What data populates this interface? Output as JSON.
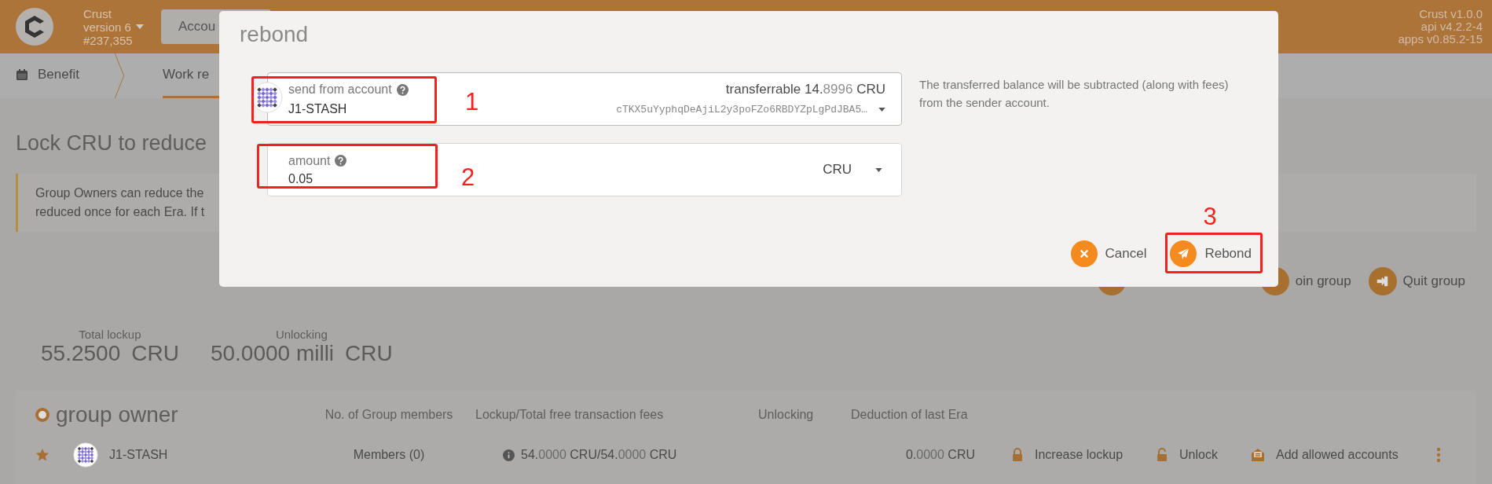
{
  "header": {
    "chain": "Crust",
    "version": "version 6",
    "block": "#237,355",
    "tabs": [
      {
        "label": "Accou"
      }
    ],
    "versions": [
      "Crust v1.0.0",
      "api v4.2.2-4",
      "apps v0.85.2-15"
    ]
  },
  "nav": [
    {
      "label": "Benefit",
      "selected": false,
      "kind": "calendar"
    },
    {
      "label": "Work re",
      "selected": true,
      "kind": "plain"
    }
  ],
  "page": {
    "heading": "Lock CRU to reduce ",
    "notice": [
      "Group Owners can reduce the",
      "reduced once for each Era. If t"
    ],
    "actions": [
      {
        "label": "oin group",
        "kind": "join"
      },
      {
        "label": "Quit group",
        "kind": "quit"
      }
    ]
  },
  "summary": [
    {
      "label": "Total lockup",
      "value": "55.2500",
      "unit": "CRU"
    },
    {
      "label": "Unlocking",
      "value": "50.0000 milli",
      "unit": "CRU"
    }
  ],
  "group": {
    "title": "group owner",
    "columns": [
      "No. of Group members",
      "Lockup/Total free transaction fees",
      "Unlocking",
      "Deduction of last Era"
    ],
    "rows": [
      {
        "name": "J1-STASH",
        "members": "Members (0)",
        "lockup": [
          {
            "text": "54.",
            "kind": "major"
          },
          {
            "text": "0000",
            "kind": "minor"
          },
          {
            "text": " CRU/54.",
            "kind": "major"
          },
          {
            "text": "0000",
            "kind": "minor"
          },
          {
            "text": " CRU",
            "kind": "major"
          }
        ],
        "deduction": [
          {
            "text": "0.",
            "kind": "major"
          },
          {
            "text": "0000",
            "kind": "minor"
          },
          {
            "text": " CRU",
            "kind": "major"
          }
        ],
        "actions": [
          {
            "label": "Increase lockup",
            "kind": "lock"
          },
          {
            "label": "Unlock",
            "kind": "unlock"
          },
          {
            "label": "Add allowed accounts",
            "kind": "mail"
          }
        ]
      }
    ]
  },
  "modal": {
    "title": "rebond",
    "account": {
      "label": "send from account",
      "name": "J1-STASH",
      "balance": [
        {
          "text": "transferrable 14.",
          "kind": "major"
        },
        {
          "text": "8996",
          "kind": "minor"
        },
        {
          "text": " CRU",
          "kind": "major"
        }
      ],
      "address": "cTKX5uYyphqDeAjiL2y3poFZo6RBDYZpLgPdJBA5…"
    },
    "amount": {
      "label": "amount",
      "value": "0.05",
      "unit": "CRU"
    },
    "help": "The transferred balance will be subtracted (along with fees) from the sender account.",
    "buttons": [
      {
        "label": "Cancel",
        "kind": "cancel"
      },
      {
        "label": "Rebond",
        "kind": "submit"
      }
    ]
  },
  "annotations": [
    {
      "number": "1"
    },
    {
      "number": "2"
    },
    {
      "number": "3"
    }
  ]
}
